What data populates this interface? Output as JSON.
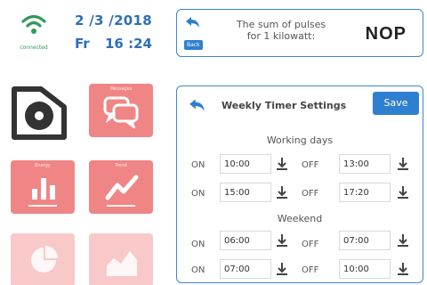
{
  "status": {
    "wifi_label": "connected",
    "date": "2 /3  /2018",
    "weekday": "Fr",
    "time": "16 :24"
  },
  "pulse_panel": {
    "back_label": "Back",
    "text_line1": "The sum of pulses",
    "text_line2": "for 1 kilowatt:",
    "value": "NOP"
  },
  "timer_panel": {
    "title": "Weekly Timer Settings",
    "save_label": "Save",
    "working_days_title": "Working days",
    "weekend_title": "Weekend",
    "on_label": "ON",
    "off_label": "OFF",
    "working_rows": [
      {
        "on": "10:00",
        "off": "13:00"
      },
      {
        "on": "15:00",
        "off": "17:20"
      }
    ],
    "weekend_rows": [
      {
        "on": "06:00",
        "off": "07:00"
      },
      {
        "on": "07:00",
        "off": "10:00"
      }
    ]
  },
  "tiles": {
    "messages_label": "Messages",
    "bar_label": "Energy",
    "trend_label": "Trend"
  },
  "colors": {
    "accent_blue": "#2e7fd0",
    "tile_red": "#f08585",
    "wifi_green": "#2e9a5a",
    "text_blue": "#2d6fb7"
  }
}
